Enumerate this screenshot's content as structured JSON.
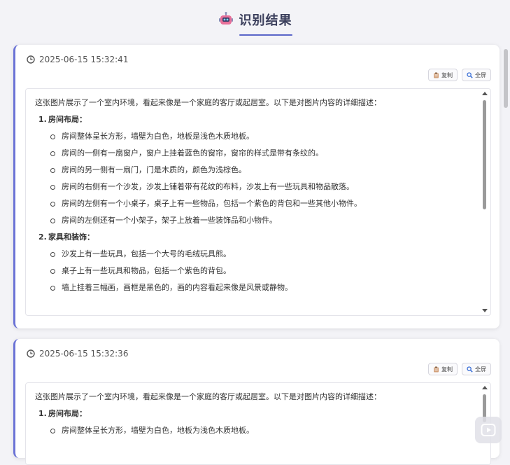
{
  "header": {
    "title": "识别结果"
  },
  "results": [
    {
      "timestamp": "2025-06-15 15:32:41",
      "copy_label": "复制",
      "fullscreen_label": "全屏",
      "intro": "这张图片展示了一个室内环境，看起来像是一个家庭的客厅或起居室。以下是对图片内容的详细描述：",
      "sections": [
        {
          "number": "1.",
          "heading": "房间布局：",
          "items": [
            "房间整体呈长方形，墙壁为白色，地板是浅色木质地板。",
            "房间的一侧有一扇窗户，窗户上挂着蓝色的窗帘，窗帘的样式是带有条纹的。",
            "房间的另一侧有一扇门，门是木质的，颜色为浅棕色。",
            "房间的右侧有一个沙发，沙发上铺着带有花纹的布料，沙发上有一些玩具和物品散落。",
            "房间的左侧有一个小桌子，桌子上有一些物品，包括一个紫色的背包和一些其他小物件。",
            "房间的左侧还有一个小架子，架子上放着一些装饰品和小物件。"
          ]
        },
        {
          "number": "2.",
          "heading": "家具和装饰：",
          "items": [
            "沙发上有一些玩具，包括一个大号的毛绒玩具熊。",
            "桌子上有一些玩具和物品，包括一个紫色的背包。",
            "墙上挂着三幅画，画框是黑色的，画的内容看起来像是风景或静物。"
          ]
        }
      ]
    },
    {
      "timestamp": "2025-06-15 15:32:36",
      "copy_label": "复制",
      "fullscreen_label": "全屏",
      "intro": "这张图片展示了一个室内环境，看起来像是一个家庭的客厅或起居室。以下是对图片内容的详细描述：",
      "sections": [
        {
          "number": "1.",
          "heading": "房间布局：",
          "items": [
            "房间整体呈长方形，墙壁为白色，地板为浅色木质地板。"
          ]
        }
      ]
    }
  ],
  "colors": {
    "accent": "#6b73d6",
    "title": "#3b3f5c",
    "background": "#f3f3f7"
  },
  "icons": {
    "header": "robot-icon",
    "timestamp": "clock-icon",
    "copy": "clipboard-icon",
    "fullscreen": "magnifier-icon",
    "overlay": "play-icon"
  }
}
